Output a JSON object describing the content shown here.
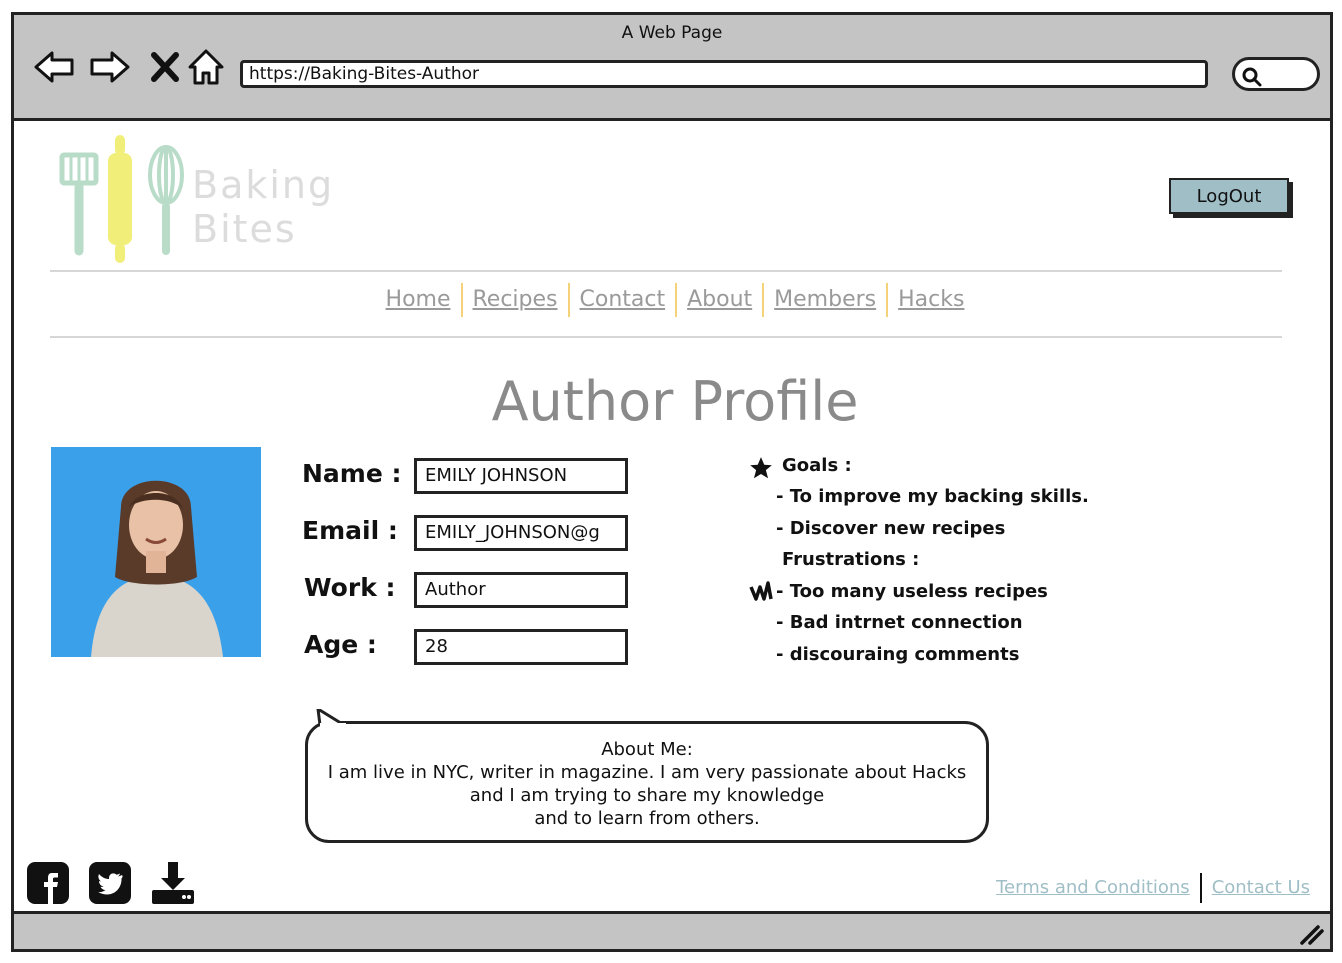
{
  "window": {
    "title": "A Web Page"
  },
  "browser": {
    "url": "https://Baking-Bites-Author"
  },
  "logo": {
    "line1": "Baking",
    "line2": "Bites"
  },
  "header": {
    "logout_label": "LogOut"
  },
  "nav": {
    "items": [
      "Home",
      "Recipes",
      "Contact",
      "About",
      "Members",
      "Hacks"
    ]
  },
  "page": {
    "title": "Author Profile"
  },
  "profile": {
    "fields": [
      {
        "label": "Name :",
        "value": "EMILY JOHNSON"
      },
      {
        "label": "Email :",
        "value": "EMILY_JOHNSON@g"
      },
      {
        "label": "Work :",
        "value": "Author"
      },
      {
        "label": "Age :",
        "value": "28"
      }
    ]
  },
  "goals": {
    "goals_heading": "Goals :",
    "goals": [
      "- To improve my backing skills.",
      "- Discover new recipes"
    ],
    "frustrations_heading": "Frustrations :",
    "frustrations": [
      "- Too many useless recipes",
      "- Bad intrnet connection",
      "- discouraing comments"
    ]
  },
  "about": {
    "heading": "About Me:",
    "lines": [
      "I am live in NYC, writer in magazine. I am very passionate about Hacks",
      "and I am trying to share my knowledge",
      "and to learn from others."
    ]
  },
  "footer": {
    "links": [
      "Terms and Conditions",
      "Contact Us"
    ]
  },
  "colors": {
    "accent": "#9fbec6",
    "nav_text": "#9a9a9a",
    "separator": "#f5d27a",
    "chrome": "#c4c4c4"
  },
  "icons": [
    "back-icon",
    "forward-icon",
    "close-icon",
    "home-icon",
    "search-icon",
    "star-icon",
    "scribble-icon",
    "facebook-icon",
    "twitter-icon",
    "download-icon",
    "resize-icon"
  ]
}
